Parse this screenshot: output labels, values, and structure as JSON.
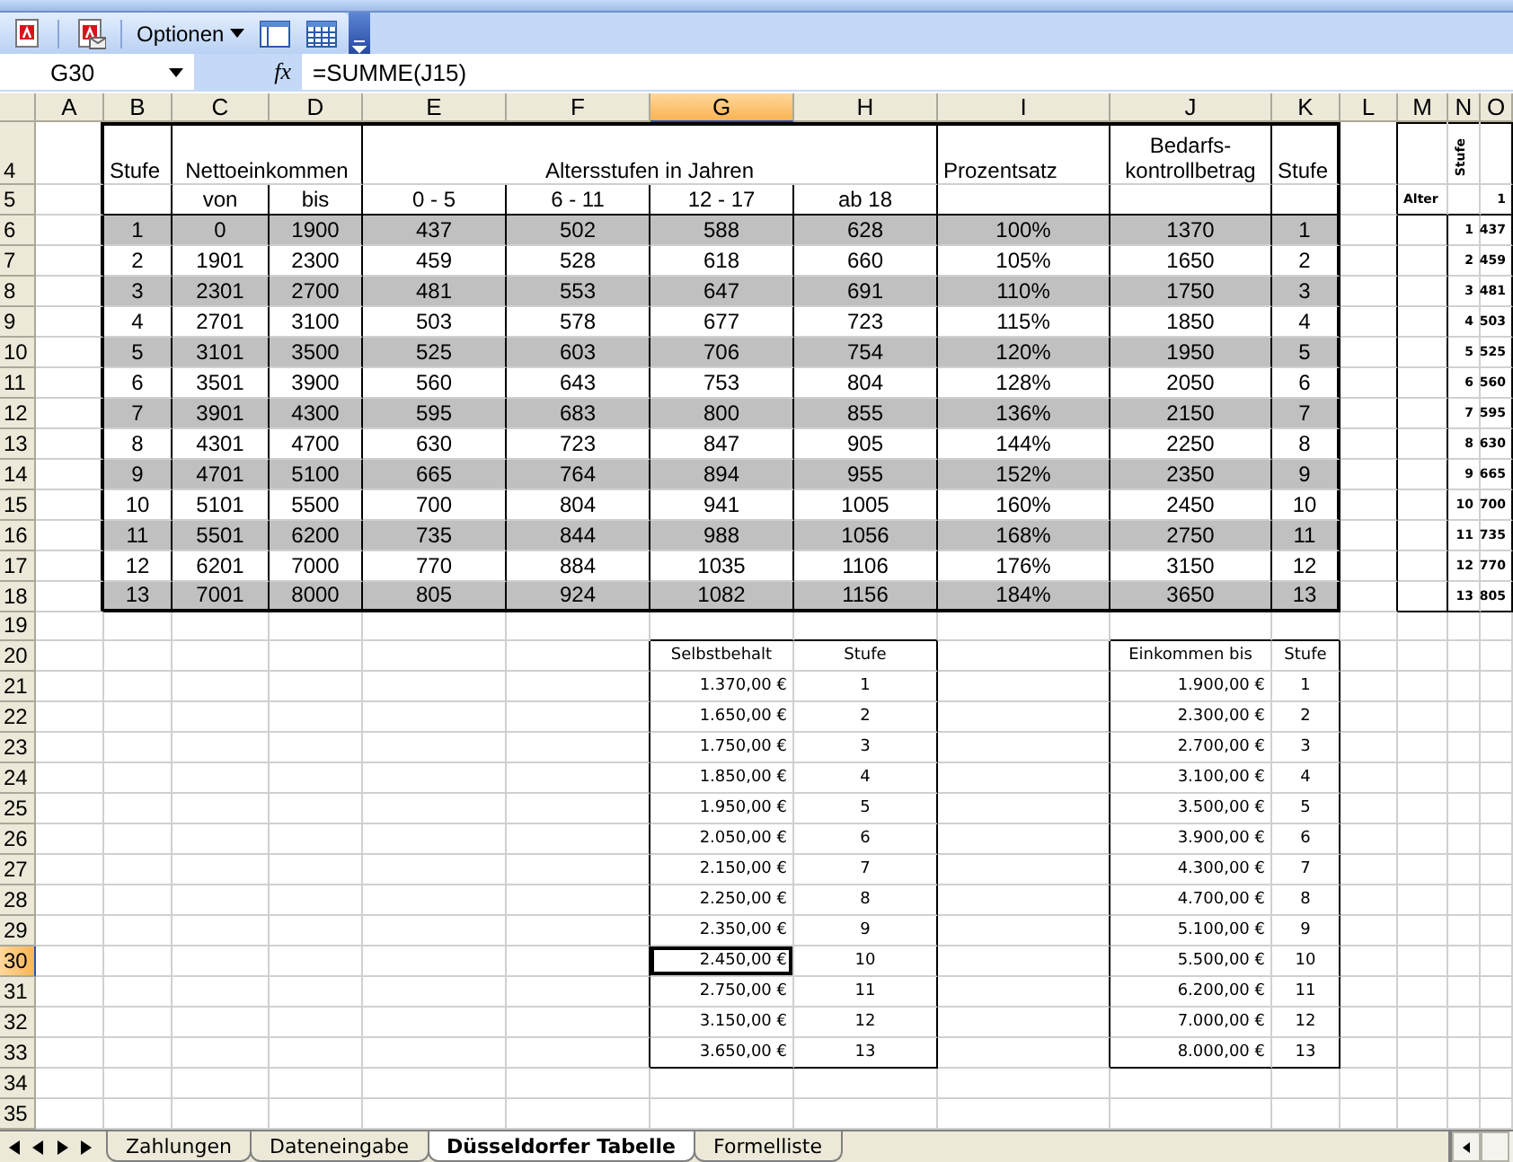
{
  "toolbar": {
    "menu_label": "Optionen"
  },
  "formula_bar": {
    "name_box": "G30",
    "function_label": "fx",
    "formula": "=SUMME(J15)"
  },
  "columns": [
    {
      "label": "A",
      "selected": false
    },
    {
      "label": "B",
      "selected": false
    },
    {
      "label": "C",
      "selected": false
    },
    {
      "label": "D",
      "selected": false
    },
    {
      "label": "E",
      "selected": false
    },
    {
      "label": "F",
      "selected": false
    },
    {
      "label": "G",
      "selected": true
    },
    {
      "label": "H",
      "selected": false
    },
    {
      "label": "I",
      "selected": false
    },
    {
      "label": "J",
      "selected": false
    },
    {
      "label": "K",
      "selected": false
    },
    {
      "label": "L",
      "selected": false
    },
    {
      "label": "M",
      "selected": false
    },
    {
      "label": "N",
      "selected": false
    },
    {
      "label": "O",
      "selected": false
    }
  ],
  "rows": [
    {
      "label": "4",
      "kind": "heading",
      "selected": false,
      "shaded": false,
      "cells": [
        null,
        "Stufe",
        {
          "t": "Nettoeinkommen",
          "across": true
        },
        null,
        {
          "t": "Altersstufen in Jahren",
          "across": true
        },
        null,
        null,
        null,
        "Prozentsatz",
        "Bedarfs-kontrollbetrag",
        "Stufe",
        null,
        null,
        "Stufe",
        null
      ]
    },
    {
      "label": "5",
      "kind": "data",
      "selected": false,
      "shaded": false,
      "cells": [
        null,
        null,
        "von",
        "bis",
        "0 - 5",
        "6 - 11",
        "12 - 17",
        "ab 18",
        null,
        null,
        null,
        null,
        "Alter",
        null,
        "1"
      ]
    },
    {
      "label": "6",
      "kind": "data",
      "selected": false,
      "shaded": true,
      "cells": [
        null,
        "1",
        "0",
        "1900",
        "437",
        "502",
        "588",
        "628",
        "100%",
        "1370",
        "1",
        null,
        null,
        "1",
        "437"
      ]
    },
    {
      "label": "7",
      "kind": "data",
      "selected": false,
      "shaded": false,
      "cells": [
        null,
        "2",
        "1901",
        "2300",
        "459",
        "528",
        "618",
        "660",
        "105%",
        "1650",
        "2",
        null,
        null,
        "2",
        "459"
      ]
    },
    {
      "label": "8",
      "kind": "data",
      "selected": false,
      "shaded": true,
      "cells": [
        null,
        "3",
        "2301",
        "2700",
        "481",
        "553",
        "647",
        "691",
        "110%",
        "1750",
        "3",
        null,
        null,
        "3",
        "481"
      ]
    },
    {
      "label": "9",
      "kind": "data",
      "selected": false,
      "shaded": false,
      "cells": [
        null,
        "4",
        "2701",
        "3100",
        "503",
        "578",
        "677",
        "723",
        "115%",
        "1850",
        "4",
        null,
        null,
        "4",
        "503"
      ]
    },
    {
      "label": "10",
      "kind": "data",
      "selected": false,
      "shaded": true,
      "cells": [
        null,
        "5",
        "3101",
        "3500",
        "525",
        "603",
        "706",
        "754",
        "120%",
        "1950",
        "5",
        null,
        null,
        "5",
        "525"
      ]
    },
    {
      "label": "11",
      "kind": "data",
      "selected": false,
      "shaded": false,
      "cells": [
        null,
        "6",
        "3501",
        "3900",
        "560",
        "643",
        "753",
        "804",
        "128%",
        "2050",
        "6",
        null,
        null,
        "6",
        "560"
      ]
    },
    {
      "label": "12",
      "kind": "data",
      "selected": false,
      "shaded": true,
      "cells": [
        null,
        "7",
        "3901",
        "4300",
        "595",
        "683",
        "800",
        "855",
        "136%",
        "2150",
        "7",
        null,
        null,
        "7",
        "595"
      ]
    },
    {
      "label": "13",
      "kind": "data",
      "selected": false,
      "shaded": false,
      "cells": [
        null,
        "8",
        "4301",
        "4700",
        "630",
        "723",
        "847",
        "905",
        "144%",
        "2250",
        "8",
        null,
        null,
        "8",
        "630"
      ]
    },
    {
      "label": "14",
      "kind": "data",
      "selected": false,
      "shaded": true,
      "cells": [
        null,
        "9",
        "4701",
        "5100",
        "665",
        "764",
        "894",
        "955",
        "152%",
        "2350",
        "9",
        null,
        null,
        "9",
        "665"
      ]
    },
    {
      "label": "15",
      "kind": "data",
      "selected": false,
      "shaded": false,
      "cells": [
        null,
        "10",
        "5101",
        "5500",
        "700",
        "804",
        "941",
        "1005",
        "160%",
        "2450",
        "10",
        null,
        null,
        "10",
        "700"
      ]
    },
    {
      "label": "16",
      "kind": "data",
      "selected": false,
      "shaded": true,
      "cells": [
        null,
        "11",
        "5501",
        "6200",
        "735",
        "844",
        "988",
        "1056",
        "168%",
        "2750",
        "11",
        null,
        null,
        "11",
        "735"
      ]
    },
    {
      "label": "17",
      "kind": "data",
      "selected": false,
      "shaded": false,
      "cells": [
        null,
        "12",
        "6201",
        "7000",
        "770",
        "884",
        "1035",
        "1106",
        "176%",
        "3150",
        "12",
        null,
        null,
        "12",
        "770"
      ]
    },
    {
      "label": "18",
      "kind": "data",
      "selected": false,
      "shaded": true,
      "cells": [
        null,
        "13",
        "7001",
        "8000",
        "805",
        "924",
        "1082",
        "1156",
        "184%",
        "3650",
        "13",
        null,
        null,
        "13",
        "805"
      ]
    },
    {
      "label": "19",
      "kind": "blank",
      "selected": false,
      "shaded": false,
      "cells": [
        null,
        null,
        null,
        null,
        null,
        null,
        null,
        null,
        null,
        null,
        null,
        null,
        null,
        null,
        null
      ]
    },
    {
      "label": "20",
      "kind": "compact-heading",
      "selected": false,
      "shaded": false,
      "cells": [
        null,
        null,
        null,
        null,
        null,
        null,
        "Selbstbehalt",
        "Stufe",
        null,
        "Einkommen bis",
        "Stufe",
        null,
        null,
        null,
        null
      ]
    },
    {
      "label": "21",
      "kind": "compact",
      "selected": false,
      "shaded": false,
      "cells": [
        null,
        null,
        null,
        null,
        null,
        null,
        "1.370,00 €",
        "1",
        null,
        "1.900,00 €",
        "1",
        null,
        null,
        null,
        null
      ]
    },
    {
      "label": "22",
      "kind": "compact",
      "selected": false,
      "shaded": false,
      "cells": [
        null,
        null,
        null,
        null,
        null,
        null,
        "1.650,00 €",
        "2",
        null,
        "2.300,00 €",
        "2",
        null,
        null,
        null,
        null
      ]
    },
    {
      "label": "23",
      "kind": "compact",
      "selected": false,
      "shaded": false,
      "cells": [
        null,
        null,
        null,
        null,
        null,
        null,
        "1.750,00 €",
        "3",
        null,
        "2.700,00 €",
        "3",
        null,
        null,
        null,
        null
      ]
    },
    {
      "label": "24",
      "kind": "compact",
      "selected": false,
      "shaded": false,
      "cells": [
        null,
        null,
        null,
        null,
        null,
        null,
        "1.850,00 €",
        "4",
        null,
        "3.100,00 €",
        "4",
        null,
        null,
        null,
        null
      ]
    },
    {
      "label": "25",
      "kind": "compact",
      "selected": false,
      "shaded": false,
      "cells": [
        null,
        null,
        null,
        null,
        null,
        null,
        "1.950,00 €",
        "5",
        null,
        "3.500,00 €",
        "5",
        null,
        null,
        null,
        null
      ]
    },
    {
      "label": "26",
      "kind": "compact",
      "selected": false,
      "shaded": false,
      "cells": [
        null,
        null,
        null,
        null,
        null,
        null,
        "2.050,00 €",
        "6",
        null,
        "3.900,00 €",
        "6",
        null,
        null,
        null,
        null
      ]
    },
    {
      "label": "27",
      "kind": "compact",
      "selected": false,
      "shaded": false,
      "cells": [
        null,
        null,
        null,
        null,
        null,
        null,
        "2.150,00 €",
        "7",
        null,
        "4.300,00 €",
        "7",
        null,
        null,
        null,
        null
      ]
    },
    {
      "label": "28",
      "kind": "compact",
      "selected": false,
      "shaded": false,
      "cells": [
        null,
        null,
        null,
        null,
        null,
        null,
        "2.250,00 €",
        "8",
        null,
        "4.700,00 €",
        "8",
        null,
        null,
        null,
        null
      ]
    },
    {
      "label": "29",
      "kind": "compact",
      "selected": false,
      "shaded": false,
      "cells": [
        null,
        null,
        null,
        null,
        null,
        null,
        "2.350,00 €",
        "9",
        null,
        "5.100,00 €",
        "9",
        null,
        null,
        null,
        null
      ]
    },
    {
      "label": "30",
      "kind": "compact",
      "selected": true,
      "shaded": false,
      "cells": [
        null,
        null,
        null,
        null,
        null,
        null,
        "2.450,00 €",
        "10",
        null,
        "5.500,00 €",
        "10",
        null,
        null,
        null,
        null
      ]
    },
    {
      "label": "31",
      "kind": "compact",
      "selected": false,
      "shaded": false,
      "cells": [
        null,
        null,
        null,
        null,
        null,
        null,
        "2.750,00 €",
        "11",
        null,
        "6.200,00 €",
        "11",
        null,
        null,
        null,
        null
      ]
    },
    {
      "label": "32",
      "kind": "compact",
      "selected": false,
      "shaded": false,
      "cells": [
        null,
        null,
        null,
        null,
        null,
        null,
        "3.150,00 €",
        "12",
        null,
        "7.000,00 €",
        "12",
        null,
        null,
        null,
        null
      ]
    },
    {
      "label": "33",
      "kind": "compact",
      "selected": false,
      "shaded": false,
      "cells": [
        null,
        null,
        null,
        null,
        null,
        null,
        "3.650,00 €",
        "13",
        null,
        "8.000,00 €",
        "13",
        null,
        null,
        null,
        null
      ]
    },
    {
      "label": "34",
      "kind": "blank",
      "selected": false,
      "shaded": false,
      "cells": [
        null,
        null,
        null,
        null,
        null,
        null,
        null,
        null,
        null,
        null,
        null,
        null,
        null,
        null,
        null
      ]
    },
    {
      "label": "35",
      "kind": "blank",
      "selected": false,
      "shaded": false,
      "cells": [
        null,
        null,
        null,
        null,
        null,
        null,
        null,
        null,
        null,
        null,
        null,
        null,
        null,
        null,
        null
      ]
    }
  ],
  "sheet_tabs": [
    {
      "label": "Zahlungen",
      "selected": false
    },
    {
      "label": "Dateneingabe",
      "selected": false
    },
    {
      "label": "Düsseldorfer Tabelle",
      "selected": true
    },
    {
      "label": "Formelliste",
      "selected": false
    }
  ]
}
